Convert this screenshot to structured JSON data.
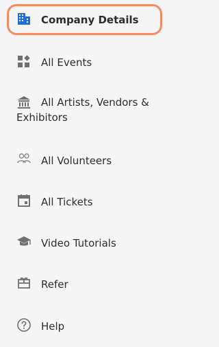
{
  "nav": {
    "items": [
      {
        "label": "Company Details",
        "icon": "building-icon",
        "active": true
      },
      {
        "label": "All Events",
        "icon": "widgets-icon"
      },
      {
        "label": "All Artists, Vendors & Exhibitors",
        "icon": "institution-icon"
      },
      {
        "label": "All Volunteers",
        "icon": "people-icon"
      },
      {
        "label": "All Tickets",
        "icon": "calendar-icon"
      },
      {
        "label": "Video Tutorials",
        "icon": "graduation-cap-icon"
      },
      {
        "label": "Refer",
        "icon": "gift-icon"
      },
      {
        "label": "Help",
        "icon": "help-circle-icon"
      }
    ]
  },
  "colors": {
    "active_border": "#f28c64",
    "active_icon": "#1f6fd6",
    "icon_gray": "#707070",
    "text": "#2d2d2d",
    "background": "#f5f5f5"
  }
}
